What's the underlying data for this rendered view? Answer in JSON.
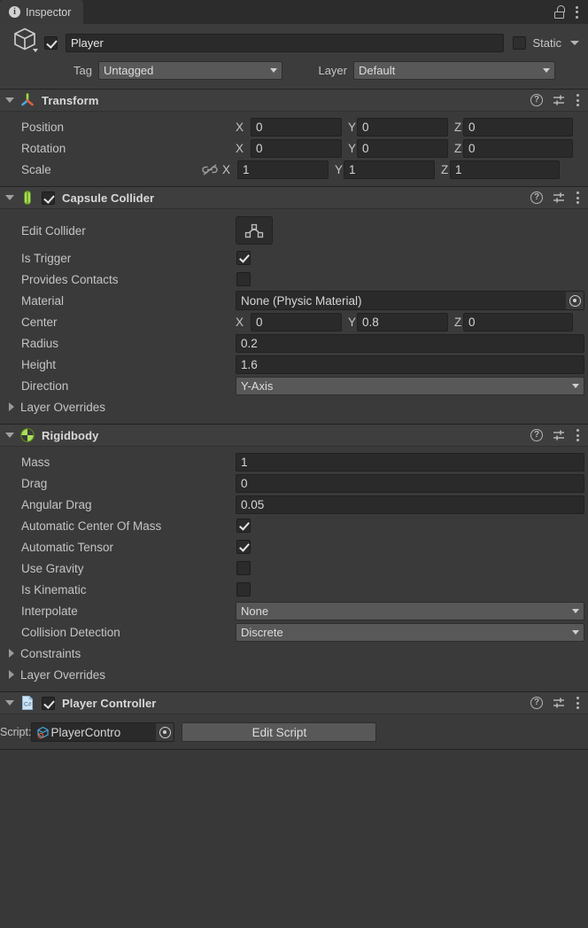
{
  "window": {
    "tab_label": "Inspector",
    "tab_icon": "info-icon",
    "lock_icon": "lock-open-icon",
    "menu_icon": "kebab-menu-icon"
  },
  "object_header": {
    "prefab_icon": "cube-icon",
    "enabled": true,
    "name": "Player",
    "static_checked": false,
    "static_label": "Static",
    "tag_label": "Tag",
    "tag_value": "Untagged",
    "layer_label": "Layer",
    "layer_value": "Default"
  },
  "components": [
    {
      "id": "transform",
      "title": "Transform",
      "icon": "transform-gizmo-icon",
      "expanded": true,
      "has_enable_checkbox": false,
      "rows": [
        {
          "type": "vector3",
          "label": "Position",
          "x": "0",
          "y": "0",
          "z": "0",
          "linked": null
        },
        {
          "type": "vector3",
          "label": "Rotation",
          "x": "0",
          "y": "0",
          "z": "0",
          "linked": null
        },
        {
          "type": "vector3",
          "label": "Scale",
          "x": "1",
          "y": "1",
          "z": "1",
          "linked": "unlink-icon"
        }
      ]
    },
    {
      "id": "capsule-collider",
      "title": "Capsule Collider",
      "icon": "capsule-collider-icon",
      "expanded": true,
      "has_enable_checkbox": true,
      "enabled": true,
      "rows": [
        {
          "type": "button",
          "label": "Edit Collider",
          "button_icon": "edit-collider-icon"
        },
        {
          "type": "checkbox",
          "label": "Is Trigger",
          "checked": true
        },
        {
          "type": "checkbox",
          "label": "Provides Contacts",
          "checked": false
        },
        {
          "type": "object",
          "label": "Material",
          "value": "None (Physic Material)"
        },
        {
          "type": "vector3",
          "label": "Center",
          "x": "0",
          "y": "0.8",
          "z": "0"
        },
        {
          "type": "text",
          "label": "Radius",
          "value": "0.2"
        },
        {
          "type": "text",
          "label": "Height",
          "value": "1.6"
        },
        {
          "type": "dropdown",
          "label": "Direction",
          "value": "Y-Axis"
        },
        {
          "type": "foldout",
          "label": "Layer Overrides"
        }
      ]
    },
    {
      "id": "rigidbody",
      "title": "Rigidbody",
      "icon": "rigidbody-icon",
      "expanded": true,
      "has_enable_checkbox": false,
      "rows": [
        {
          "type": "text",
          "label": "Mass",
          "value": "1"
        },
        {
          "type": "text",
          "label": "Drag",
          "value": "0"
        },
        {
          "type": "text",
          "label": "Angular Drag",
          "value": "0.05"
        },
        {
          "type": "checkbox",
          "label": "Automatic Center Of Mass",
          "checked": true
        },
        {
          "type": "checkbox",
          "label": "Automatic Tensor",
          "checked": true
        },
        {
          "type": "checkbox",
          "label": "Use Gravity",
          "checked": false
        },
        {
          "type": "checkbox",
          "label": "Is Kinematic",
          "checked": false
        },
        {
          "type": "dropdown",
          "label": "Interpolate",
          "value": "None"
        },
        {
          "type": "dropdown",
          "label": "Collision Detection",
          "value": "Discrete"
        },
        {
          "type": "foldout",
          "label": "Constraints"
        },
        {
          "type": "foldout",
          "label": "Layer Overrides"
        }
      ]
    },
    {
      "id": "player-controller",
      "title": "Player Controller",
      "icon": "csharp-script-icon",
      "expanded": true,
      "has_enable_checkbox": true,
      "enabled": true,
      "rows": [
        {
          "type": "script",
          "label": "Script:",
          "value": "PlayerContro",
          "script_icon": "script-asset-icon",
          "button_label": "Edit Script"
        }
      ]
    }
  ],
  "header_icons": {
    "help": "?",
    "preset": "preset-icon",
    "menu": "kebab-menu-icon"
  },
  "colors": {
    "panel_bg": "#383838",
    "component_header": "#3e3e3e",
    "field_bg": "#2a2a2a",
    "dropdown_bg": "#585858",
    "accent_green": "#a8e05a",
    "text": "#c4c4c4"
  }
}
